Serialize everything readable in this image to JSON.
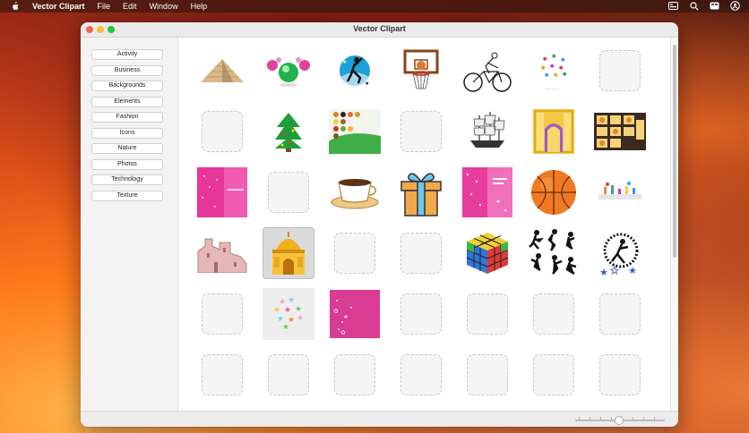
{
  "menubar": {
    "app_name": "Vector Clipart",
    "menus": [
      "File",
      "Edit",
      "Window",
      "Help"
    ],
    "status_icons": [
      "control-center-icon",
      "search-icon",
      "display-icon",
      "user-icon"
    ]
  },
  "window": {
    "title": "Vector Clipart"
  },
  "sidebar": {
    "categories": [
      "Activity",
      "Business",
      "Backgrounds",
      "Elements",
      "Fashion",
      "Icons",
      "Nature",
      "Photos",
      "Technology",
      "Texture"
    ]
  },
  "grid": {
    "columns": 7,
    "cells": [
      "pyramid-image",
      "christmas-ornaments-image",
      "basketball-player-image",
      "basketball-hoop-image",
      "cyclist-image",
      "confetti-circle-image",
      "empty",
      "empty",
      "christmas-tree-image",
      "food-icons-image",
      "empty",
      "sailing-ship-image",
      "golden-door-image",
      "photo-frames-image",
      "pink-card-image",
      "empty",
      "coffee-cup-image",
      "gift-box-image",
      "pink-greeting-card-image",
      "basketball-image",
      "party-image",
      "pink-building-image",
      "golden-temple-image",
      "empty",
      "empty",
      "rubiks-cube-image",
      "sports-silhouettes-image",
      "dancer-stars-image",
      "empty",
      "colorful-stars-image",
      "pink-sparkle-image",
      "empty",
      "empty",
      "empty",
      "empty",
      "empty",
      "empty",
      "empty",
      "empty",
      "empty",
      "empty",
      "empty"
    ],
    "selected_index": 22
  },
  "colors": {
    "accent_pink": "#e8359a",
    "selection_gray": "#dadada"
  }
}
